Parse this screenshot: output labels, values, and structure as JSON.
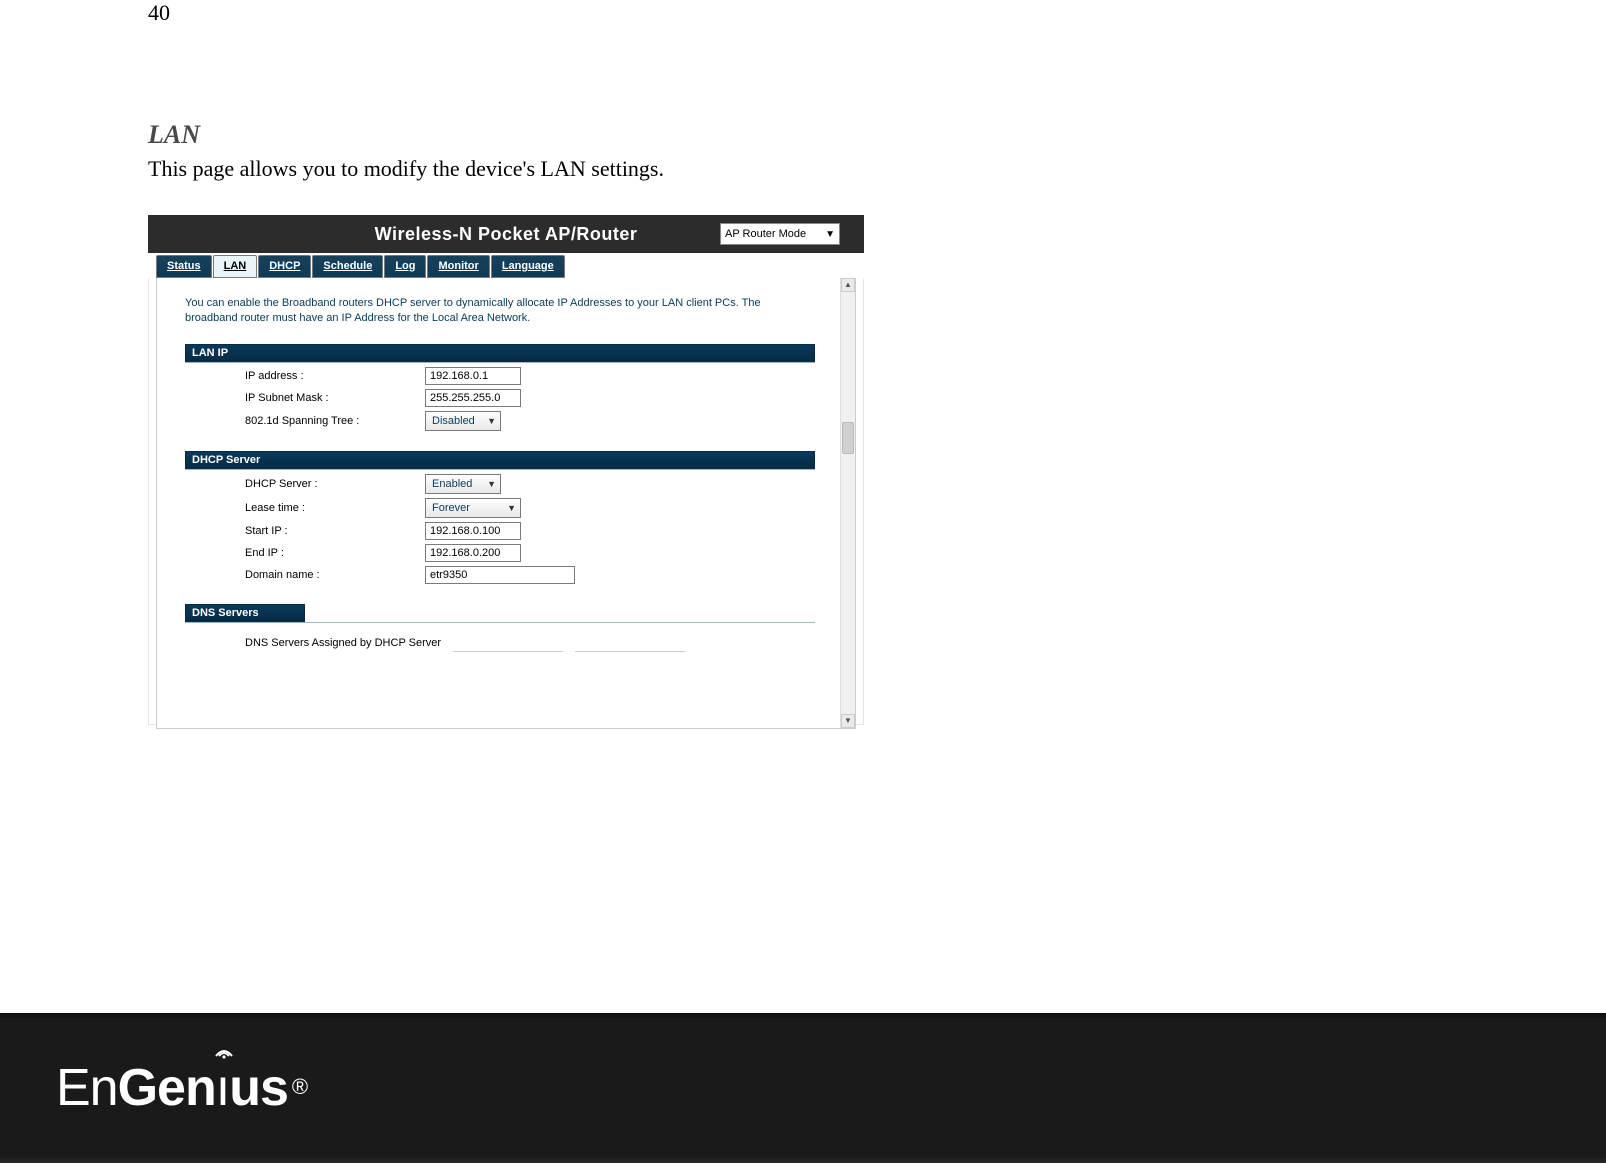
{
  "page_number": "40",
  "section_heading": "LAN",
  "section_text": "This page allows you to modify the device's LAN settings.",
  "router": {
    "title": "Wireless-N Pocket AP/Router",
    "mode_selected": "AP Router Mode",
    "tabs": [
      "Status",
      "LAN",
      "DHCP",
      "Schedule",
      "Log",
      "Monitor",
      "Language"
    ],
    "active_tab_index": 1,
    "description": "You can enable the Broadband routers DHCP server to dynamically allocate IP Addresses to your LAN client PCs. The broadband router must have an IP Address for the Local Area Network.",
    "lan_ip": {
      "header": "LAN IP",
      "ip_label": "IP address :",
      "ip_value": "192.168.0.1",
      "mask_label": "IP Subnet Mask :",
      "mask_value": "255.255.255.0",
      "stp_label": "802.1d Spanning Tree :",
      "stp_value": "Disabled"
    },
    "dhcp": {
      "header": "DHCP Server",
      "server_label": "DHCP Server :",
      "server_value": "Enabled",
      "lease_label": "Lease time :",
      "lease_value": "Forever",
      "start_label": "Start IP :",
      "start_value": "192.168.0.100",
      "end_label": "End IP :",
      "end_value": "192.168.0.200",
      "domain_label": "Domain name :",
      "domain_value": "etr9350"
    },
    "dns": {
      "header": "DNS Servers",
      "assigned_text": "DNS Servers Assigned by DHCP Server"
    }
  },
  "brand": "EnGenius",
  "brand_reg": "®"
}
